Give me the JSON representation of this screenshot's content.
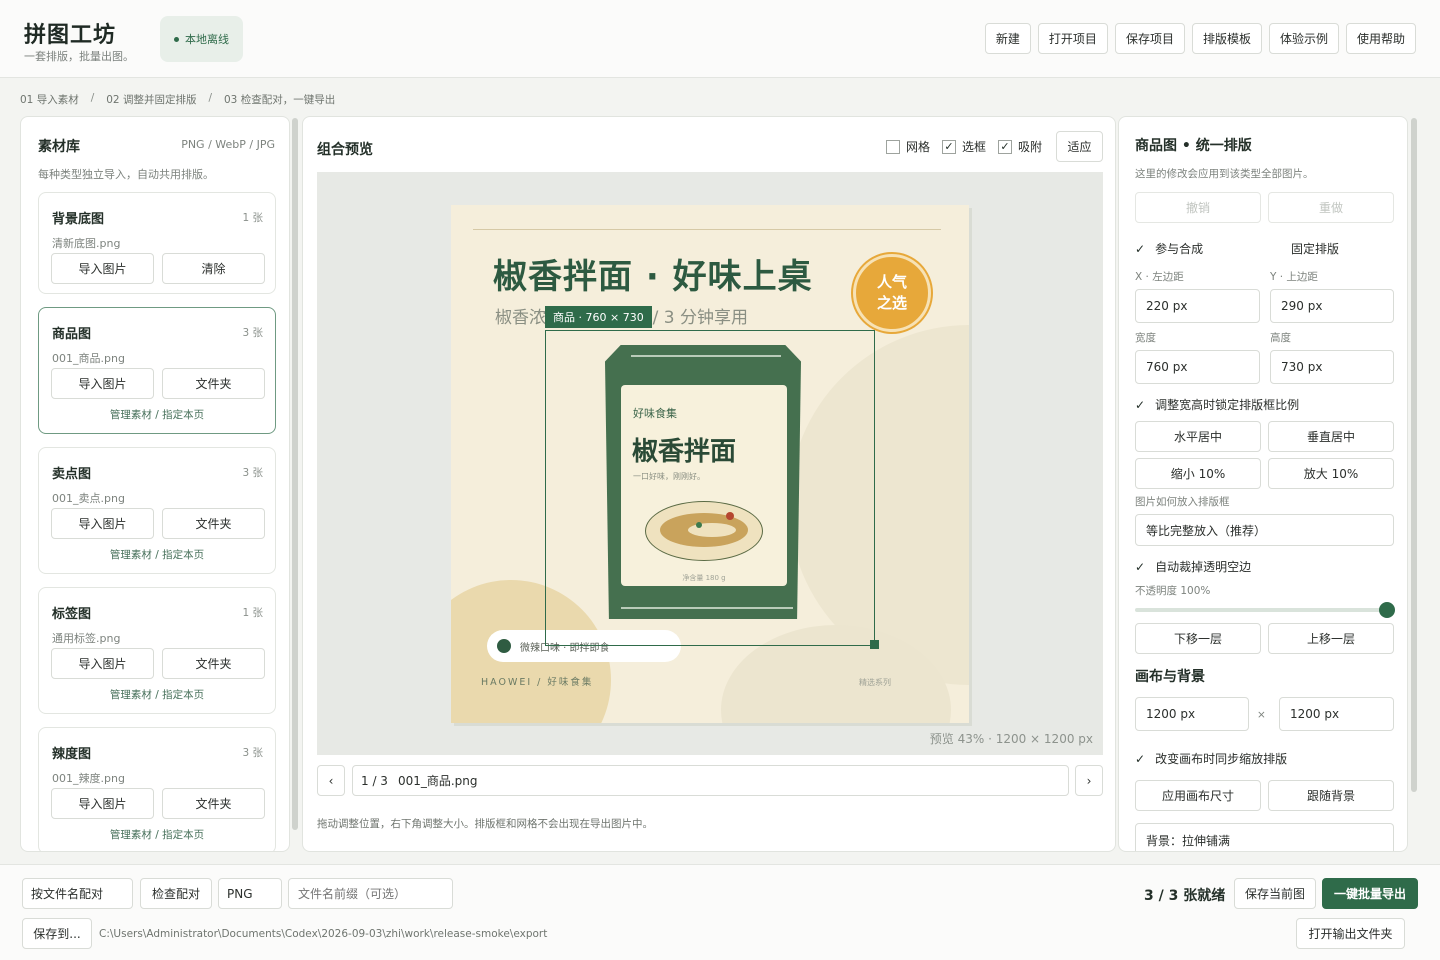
{
  "header": {
    "title": "拼图工坊",
    "subtitle": "一套排版，批量出图。",
    "offline_badge": "本地离线",
    "actions": [
      "新建",
      "打开项目",
      "保存项目",
      "排版模板",
      "体验示例",
      "使用帮助"
    ]
  },
  "breadcrumb": [
    "01  导入素材",
    "/",
    "02  调整并固定排版",
    "/",
    "03  检查配对，一键导出"
  ],
  "library": {
    "title": "素材库",
    "formats": "PNG / WebP / JPG",
    "desc": "每种类型独立导入，自动共用排版。",
    "cards": [
      {
        "name": "背景底图",
        "count": "1 张",
        "file": "清新底图.png",
        "btn1": "导入图片",
        "btn2": "清除",
        "link": ""
      },
      {
        "name": "商品图",
        "count": "3 张",
        "file": "001_商品.png",
        "btn1": "导入图片",
        "btn2": "文件夹",
        "link": "管理素材 / 指定本页"
      },
      {
        "name": "卖点图",
        "count": "3 张",
        "file": "001_卖点.png",
        "btn1": "导入图片",
        "btn2": "文件夹",
        "link": "管理素材 / 指定本页"
      },
      {
        "name": "标签图",
        "count": "1 张",
        "file": "通用标签.png",
        "btn1": "导入图片",
        "btn2": "文件夹",
        "link": "管理素材 / 指定本页"
      },
      {
        "name": "辣度图",
        "count": "3 张",
        "file": "001_辣度.png",
        "btn1": "导入图片",
        "btn2": "文件夹",
        "link": "管理素材 / 指定本页"
      }
    ]
  },
  "preview": {
    "title": "组合预览",
    "options": [
      {
        "label": "网格",
        "checked": ""
      },
      {
        "label": "选框",
        "checked": "✓"
      },
      {
        "label": "吸附",
        "checked": "✓"
      }
    ],
    "fit_label": "适应",
    "meta": "预览 43%  ·  1200 × 1200 px",
    "selection_tag": "商品 · 760 × 730",
    "prev": "‹",
    "next": "›",
    "page": "1 / 3",
    "file": "001_商品.png",
    "hint": "拖动调整位置，右下角调整大小。排版框和网格不会出现在导出图片中。"
  },
  "poster": {
    "headline": "椒香拌面  ·  好味上桌",
    "subline": "椒香浓郁  ·  清爽劲道  /  3 分钟享用",
    "badge_l1": "人气",
    "badge_l2": "之选",
    "bag_brand": "好味食集",
    "bag_name": "椒香拌面",
    "bag_tag": "一口好味，刚刚好。",
    "bag_weight": "净含量  180 g",
    "pill": "微辣口味  ·  即拌即食",
    "brand": "HAOWEI  /  好味食集",
    "series": "精选系列"
  },
  "props": {
    "title": "商品图 • 统一排版",
    "desc": "这里的修改会应用到该类型全部图片。",
    "undo": "撤销",
    "redo": "重做",
    "include": "参与合成",
    "fixed": "固定排版",
    "x_label": "X · 左边距",
    "y_label": "Y · 上边距",
    "x": "220 px",
    "y": "290 px",
    "w_label": "宽度",
    "h_label": "高度",
    "w": "760 px",
    "h": "730 px",
    "lock_ratio": "调整宽高时锁定排版框比例",
    "center_h": "水平居中",
    "center_v": "垂直居中",
    "shrink": "缩小 10%",
    "enlarge": "放大 10%",
    "fit_label": "图片如何放入排版框",
    "fit_value": "等比完整放入（推荐）",
    "auto_crop": "自动裁掉透明空边",
    "opacity_label": "不透明度 100%",
    "opacity": 1.0,
    "down": "下移一层",
    "up": "上移一层",
    "canvas_title": "画布与背景",
    "canvas_w": "1200 px",
    "times": "×",
    "canvas_h": "1200 px",
    "sync_scale": "改变画布时同步缩放排版",
    "apply_size": "应用画布尺寸",
    "follow_bg": "跟随背景",
    "bg_mode": "背景：拉伸铺满"
  },
  "footer": {
    "match_by": "按文件名配对",
    "check": "检查配对",
    "format": "PNG",
    "prefix_placeholder": "文件名前缀（可选）",
    "save_to": "保存到...",
    "path": "C:\\Users\\Administrator\\Documents\\Codex\\2026-09-03\\zhi\\work\\release-smoke\\export",
    "ready": "3 / 3 张就绪",
    "save_current": "保存当前图",
    "export_all": "一键批量导出",
    "open_folder": "打开输出文件夹"
  },
  "colors": {
    "accent": "#2f6b4a",
    "badge": "#e7a83a",
    "poster_bg": "#f5eedb"
  }
}
